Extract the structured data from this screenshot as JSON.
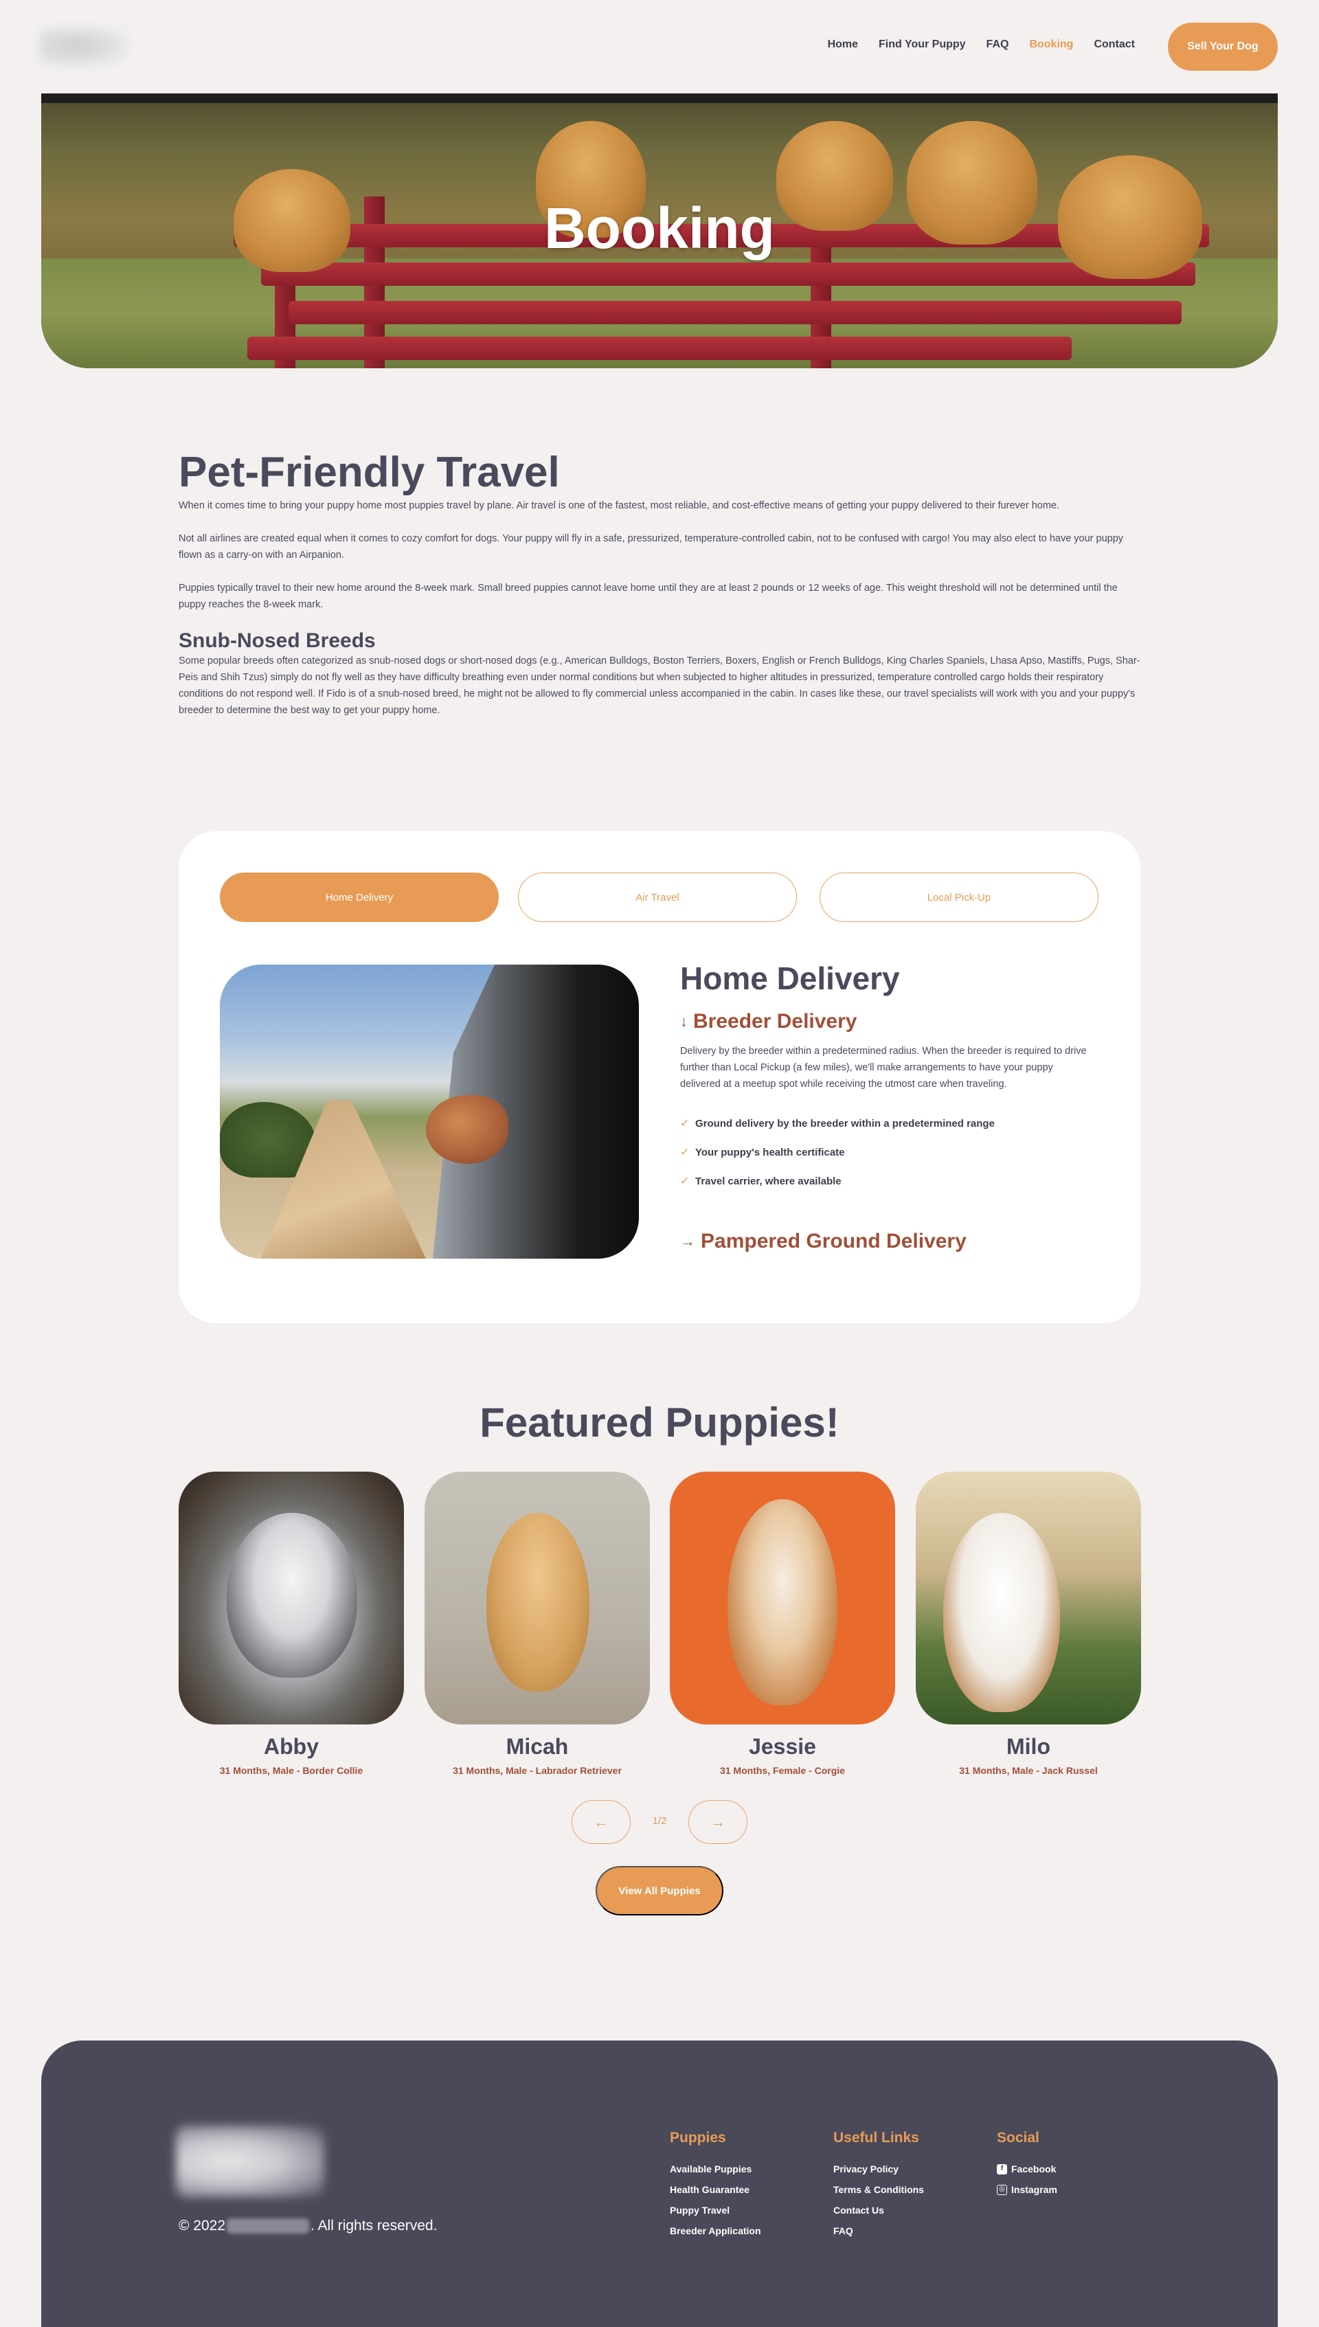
{
  "nav": {
    "items": [
      "Home",
      "Find Your Puppy",
      "FAQ",
      "Booking",
      "Contact"
    ],
    "active": "Booking",
    "cta": "Sell Your Dog"
  },
  "hero": {
    "title": "Booking"
  },
  "intro": {
    "title": "Pet-Friendly Travel",
    "paragraphs": [
      "When it comes time to bring your puppy home most puppies travel by plane. Air travel is one of the fastest, most reliable, and cost-effective means of getting your puppy delivered to their furever home.",
      "Not all airlines are created equal when it comes to cozy comfort for dogs. Your puppy will fly in a safe, pressurized, temperature-controlled cabin, not to be confused with cargo! You may also elect to have your puppy flown as a carry-on with an Airpanion.",
      "Puppies typically travel to their new home around the 8-week mark. Small breed puppies cannot leave home until they are at least 2 pounds or 12 weeks of age. This weight threshold will not be determined until the puppy reaches the 8-week mark."
    ],
    "subtitle": "Snub-Nosed Breeds",
    "subtitle_paragraph": "Some popular breeds often categorized as snub-nosed dogs or short-nosed dogs (e.g., American Bulldogs, Boston Terriers, Boxers, English or French Bulldogs, King Charles Spaniels, Lhasa Apso, Mastiffs, Pugs, Shar-Peis and Shih Tzus) simply do not fly well as they have difficulty breathing even under normal conditions but when subjected to higher altitudes in pressurized, temperature controlled cargo holds their respiratory conditions do not respond well. If Fido is of a snub-nosed breed, he might not be allowed to fly commercial unless accompanied in the cabin. In cases like these, our travel specialists will work with you and your puppy's breeder to determine the best way to get your puppy home."
  },
  "delivery": {
    "tabs": [
      "Home Delivery",
      "Air Travel",
      "Local Pick-Up"
    ],
    "active_tab": "Home Delivery",
    "title": "Home Delivery",
    "option1": {
      "arrow": "↓",
      "title": "Breeder Delivery",
      "text": "Delivery by the breeder within a predetermined radius. When the breeder is required to drive further than Local Pickup (a few miles), we'll make arrangements to have your puppy delivered at a meetup spot while receiving the utmost care when traveling.",
      "checks": [
        "Ground delivery by the breeder within a predetermined range",
        "Your puppy's health certificate",
        "Travel carrier, where available"
      ]
    },
    "option2": {
      "arrow": "→",
      "title": "Pampered Ground Delivery"
    }
  },
  "featured": {
    "title": "Featured Puppies!",
    "puppies": [
      {
        "name": "Abby",
        "info": "31 Months, Male - Border Collie"
      },
      {
        "name": "Micah",
        "info": "31 Months, Male - Labrador Retriever"
      },
      {
        "name": "Jessie",
        "info": "31 Months, Female - Corgie"
      },
      {
        "name": "Milo",
        "info": "31 Months, Male - Jack Russel"
      }
    ],
    "pager": {
      "prev": "←",
      "label": "1/2",
      "next": "→"
    },
    "view_all": "View All Puppies"
  },
  "footer": {
    "copyright_prefix": "© 2022",
    "copyright_suffix": ". All rights reserved.",
    "columns": [
      {
        "title": "Puppies",
        "links": [
          "Available Puppies",
          "Health Guarantee",
          "Puppy Travel",
          "Breeder Application"
        ]
      },
      {
        "title": "Useful Links",
        "links": [
          "Privacy Policy",
          "Terms & Conditions",
          "Contact Us",
          "FAQ"
        ]
      },
      {
        "title": "Social",
        "links": [
          "Facebook",
          "Instagram"
        ]
      }
    ]
  },
  "colors": {
    "accent": "#e89b55",
    "heading": "#4a4a5c",
    "rust": "#a14f38",
    "footer_bg": "#4a4959",
    "page_bg": "#f4f0f0"
  },
  "icons": [
    "arrow-down-icon",
    "arrow-right-icon",
    "check-icon",
    "arrow-left-icon",
    "facebook-icon",
    "instagram-icon"
  ]
}
